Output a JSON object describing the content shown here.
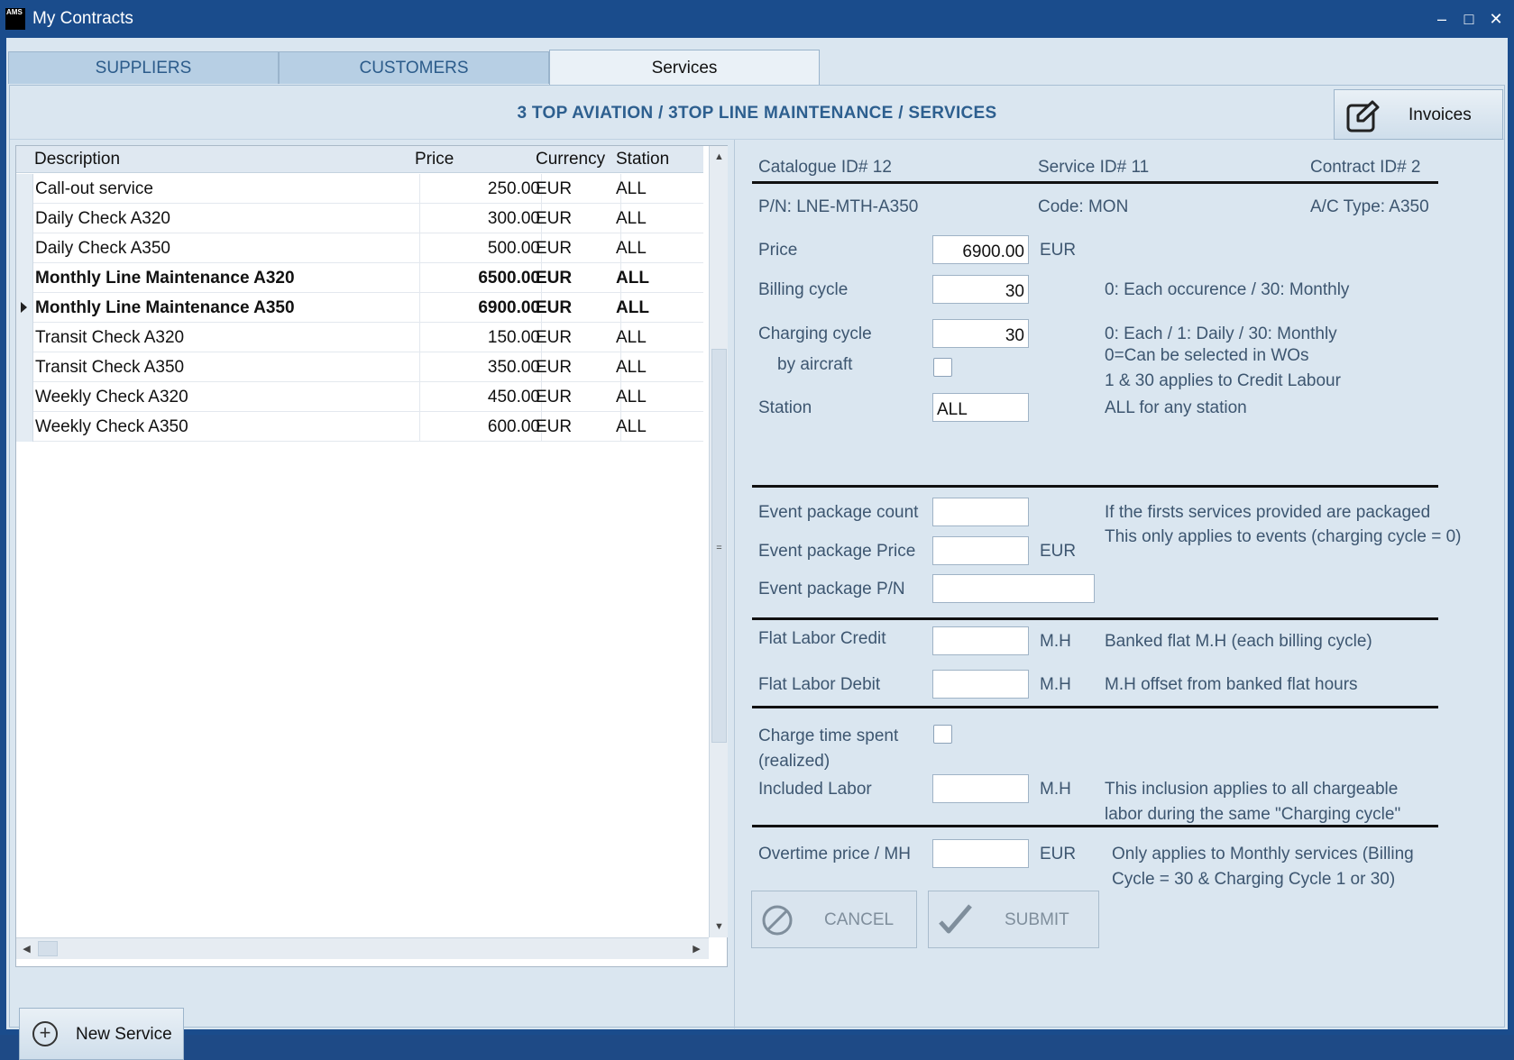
{
  "window": {
    "title": "My Contracts",
    "icon_letters": "AMS",
    "minimize_glyph": "–",
    "maximize_glyph": "□",
    "close_glyph": "✕"
  },
  "tabs": [
    {
      "label": "SUPPLIERS",
      "active": false
    },
    {
      "label": "CUSTOMERS",
      "active": false
    },
    {
      "label": "Services",
      "active": true
    }
  ],
  "header": {
    "heading": "3 TOP AVIATION / 3TOP LINE MAINTENANCE / SERVICES",
    "invoices_label": "Invoices"
  },
  "grid": {
    "columns": [
      "Description",
      "Price",
      "Currency",
      "Station"
    ],
    "rows": [
      {
        "description": "Call-out service",
        "price": "250.00",
        "currency": "EUR",
        "station": "ALL"
      },
      {
        "description": "Daily Check A320",
        "price": "300.00",
        "currency": "EUR",
        "station": "ALL"
      },
      {
        "description": "Daily Check A350",
        "price": "500.00",
        "currency": "EUR",
        "station": "ALL"
      },
      {
        "description": "Monthly Line Maintenance A320",
        "price": "6500.00",
        "currency": "EUR",
        "station": "ALL"
      },
      {
        "description": "Monthly Line Maintenance A350",
        "price": "6900.00",
        "currency": "EUR",
        "station": "ALL"
      },
      {
        "description": "Transit Check  A320",
        "price": "150.00",
        "currency": "EUR",
        "station": "ALL"
      },
      {
        "description": "Transit Check A350",
        "price": "350.00",
        "currency": "EUR",
        "station": "ALL"
      },
      {
        "description": "Weekly Check A320",
        "price": "450.00",
        "currency": "EUR",
        "station": "ALL"
      },
      {
        "description": "Weekly Check A350",
        "price": "600.00",
        "currency": "EUR",
        "station": "ALL"
      }
    ],
    "selected_row": 4,
    "bold_rows": [
      3,
      4
    ],
    "splitter_glyph": "="
  },
  "new_service_label": "New Service",
  "form": {
    "catalogue_id": "Catalogue ID# 12",
    "service_id": "Service ID#  11",
    "contract_id": "Contract ID#  2",
    "pn": "P/N:  LNE-MTH-A350",
    "code": "Code:  MON",
    "ac_type": "A/C Type:  A350",
    "price_label": "Price",
    "price_value": "6900.00",
    "price_unit": "EUR",
    "billing_label": "Billing cycle",
    "billing_value": "30",
    "billing_hint": "0: Each occurence / 30: Monthly",
    "charging_label": "Charging cycle",
    "charging_value": "30",
    "charging_hint1": "0: Each / 1: Daily / 30: Monthly",
    "charging_hint2": "0=Can be selected in WOs",
    "charging_hint3": "1 & 30 applies to Credit Labour",
    "by_aircraft_label": "by aircraft",
    "by_aircraft_checked": false,
    "station_label": "Station",
    "station_value": "ALL",
    "station_hint": "ALL for any station",
    "event_count_label": "Event package count",
    "event_count_value": "",
    "event_hint1": "If the firsts services provided are packaged",
    "event_hint2": "This only applies to events (charging cycle = 0)",
    "event_price_label": "Event package Price",
    "event_price_value": "",
    "event_price_unit": "EUR",
    "event_pn_label": "Event package P/N",
    "event_pn_value": "",
    "flat_credit_label": "Flat Labor Credit",
    "flat_credit_value": "",
    "flat_credit_unit": "M.H",
    "flat_credit_hint": "Banked flat M.H (each billing cycle)",
    "flat_debit_label": "Flat Labor Debit",
    "flat_debit_value": "",
    "flat_debit_unit": "M.H",
    "flat_debit_hint": "M.H offset from banked flat hours",
    "charge_time_label": "Charge time spent",
    "charge_time_label2": "(realized)",
    "charge_time_checked": false,
    "included_label": "Included Labor",
    "included_value": "",
    "included_unit": "M.H",
    "included_hint1": "This inclusion applies to all chargeable",
    "included_hint2": "labor during the same \"Charging cycle\"",
    "overtime_label": "Overtime price / MH",
    "overtime_value": "",
    "overtime_unit": "EUR",
    "overtime_hint1": "Only applies to Monthly services (Billing",
    "overtime_hint2": "Cycle = 30 & Charging Cycle 1 or 30)",
    "cancel_label": "CANCEL",
    "submit_label": "SUBMIT"
  },
  "colors": {
    "titlebar": "#1a4c8c",
    "panel": "#dae6f0",
    "heading": "#2d5f8f",
    "label": "#3d5670"
  }
}
